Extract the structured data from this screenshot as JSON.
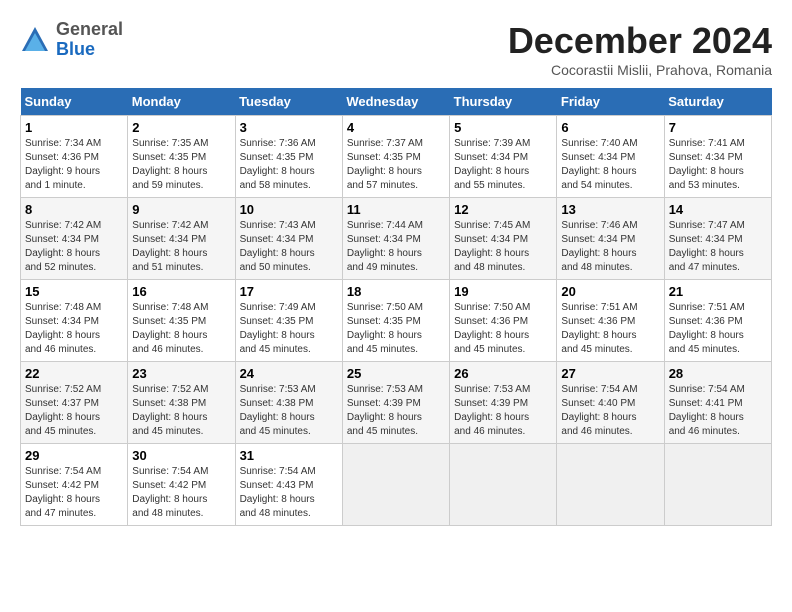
{
  "logo": {
    "general": "General",
    "blue": "Blue"
  },
  "title": "December 2024",
  "subtitle": "Cocorastii Mislii, Prahova, Romania",
  "days_header": [
    "Sunday",
    "Monday",
    "Tuesday",
    "Wednesday",
    "Thursday",
    "Friday",
    "Saturday"
  ],
  "weeks": [
    [
      {
        "num": "1",
        "info": "Sunrise: 7:34 AM\nSunset: 4:36 PM\nDaylight: 9 hours\nand 1 minute."
      },
      {
        "num": "2",
        "info": "Sunrise: 7:35 AM\nSunset: 4:35 PM\nDaylight: 8 hours\nand 59 minutes."
      },
      {
        "num": "3",
        "info": "Sunrise: 7:36 AM\nSunset: 4:35 PM\nDaylight: 8 hours\nand 58 minutes."
      },
      {
        "num": "4",
        "info": "Sunrise: 7:37 AM\nSunset: 4:35 PM\nDaylight: 8 hours\nand 57 minutes."
      },
      {
        "num": "5",
        "info": "Sunrise: 7:39 AM\nSunset: 4:34 PM\nDaylight: 8 hours\nand 55 minutes."
      },
      {
        "num": "6",
        "info": "Sunrise: 7:40 AM\nSunset: 4:34 PM\nDaylight: 8 hours\nand 54 minutes."
      },
      {
        "num": "7",
        "info": "Sunrise: 7:41 AM\nSunset: 4:34 PM\nDaylight: 8 hours\nand 53 minutes."
      }
    ],
    [
      {
        "num": "8",
        "info": "Sunrise: 7:42 AM\nSunset: 4:34 PM\nDaylight: 8 hours\nand 52 minutes."
      },
      {
        "num": "9",
        "info": "Sunrise: 7:42 AM\nSunset: 4:34 PM\nDaylight: 8 hours\nand 51 minutes."
      },
      {
        "num": "10",
        "info": "Sunrise: 7:43 AM\nSunset: 4:34 PM\nDaylight: 8 hours\nand 50 minutes."
      },
      {
        "num": "11",
        "info": "Sunrise: 7:44 AM\nSunset: 4:34 PM\nDaylight: 8 hours\nand 49 minutes."
      },
      {
        "num": "12",
        "info": "Sunrise: 7:45 AM\nSunset: 4:34 PM\nDaylight: 8 hours\nand 48 minutes."
      },
      {
        "num": "13",
        "info": "Sunrise: 7:46 AM\nSunset: 4:34 PM\nDaylight: 8 hours\nand 48 minutes."
      },
      {
        "num": "14",
        "info": "Sunrise: 7:47 AM\nSunset: 4:34 PM\nDaylight: 8 hours\nand 47 minutes."
      }
    ],
    [
      {
        "num": "15",
        "info": "Sunrise: 7:48 AM\nSunset: 4:34 PM\nDaylight: 8 hours\nand 46 minutes."
      },
      {
        "num": "16",
        "info": "Sunrise: 7:48 AM\nSunset: 4:35 PM\nDaylight: 8 hours\nand 46 minutes."
      },
      {
        "num": "17",
        "info": "Sunrise: 7:49 AM\nSunset: 4:35 PM\nDaylight: 8 hours\nand 45 minutes."
      },
      {
        "num": "18",
        "info": "Sunrise: 7:50 AM\nSunset: 4:35 PM\nDaylight: 8 hours\nand 45 minutes."
      },
      {
        "num": "19",
        "info": "Sunrise: 7:50 AM\nSunset: 4:36 PM\nDaylight: 8 hours\nand 45 minutes."
      },
      {
        "num": "20",
        "info": "Sunrise: 7:51 AM\nSunset: 4:36 PM\nDaylight: 8 hours\nand 45 minutes."
      },
      {
        "num": "21",
        "info": "Sunrise: 7:51 AM\nSunset: 4:36 PM\nDaylight: 8 hours\nand 45 minutes."
      }
    ],
    [
      {
        "num": "22",
        "info": "Sunrise: 7:52 AM\nSunset: 4:37 PM\nDaylight: 8 hours\nand 45 minutes."
      },
      {
        "num": "23",
        "info": "Sunrise: 7:52 AM\nSunset: 4:38 PM\nDaylight: 8 hours\nand 45 minutes."
      },
      {
        "num": "24",
        "info": "Sunrise: 7:53 AM\nSunset: 4:38 PM\nDaylight: 8 hours\nand 45 minutes."
      },
      {
        "num": "25",
        "info": "Sunrise: 7:53 AM\nSunset: 4:39 PM\nDaylight: 8 hours\nand 45 minutes."
      },
      {
        "num": "26",
        "info": "Sunrise: 7:53 AM\nSunset: 4:39 PM\nDaylight: 8 hours\nand 46 minutes."
      },
      {
        "num": "27",
        "info": "Sunrise: 7:54 AM\nSunset: 4:40 PM\nDaylight: 8 hours\nand 46 minutes."
      },
      {
        "num": "28",
        "info": "Sunrise: 7:54 AM\nSunset: 4:41 PM\nDaylight: 8 hours\nand 46 minutes."
      }
    ],
    [
      {
        "num": "29",
        "info": "Sunrise: 7:54 AM\nSunset: 4:42 PM\nDaylight: 8 hours\nand 47 minutes."
      },
      {
        "num": "30",
        "info": "Sunrise: 7:54 AM\nSunset: 4:42 PM\nDaylight: 8 hours\nand 48 minutes."
      },
      {
        "num": "31",
        "info": "Sunrise: 7:54 AM\nSunset: 4:43 PM\nDaylight: 8 hours\nand 48 minutes."
      },
      null,
      null,
      null,
      null
    ]
  ]
}
